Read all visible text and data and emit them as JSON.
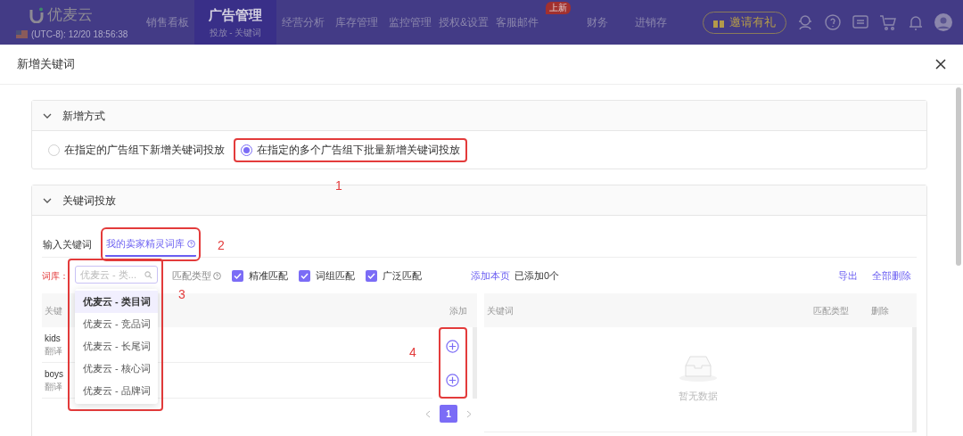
{
  "top_nav": {
    "logo": "优麦云",
    "clock": "(UTC-8): 12/20 18:56:38",
    "items": [
      {
        "label": "销售看板",
        "selected": false
      },
      {
        "label": "广告管理",
        "selected": true,
        "subtitle": "投放 - 关键词"
      },
      {
        "label": "经营分析",
        "selected": false
      },
      {
        "label": "库存管理",
        "selected": false
      },
      {
        "label": "监控管理",
        "selected": false
      },
      {
        "label": "授权&设置",
        "selected": false
      },
      {
        "label": "客服邮件",
        "selected": false,
        "badge": "上新"
      },
      {
        "label": "财务",
        "selected": false
      },
      {
        "label": "进销存",
        "selected": false
      }
    ],
    "invite_button": "邀请有礼"
  },
  "dialog": {
    "title": "新增关键词",
    "method_panel": {
      "title": "新增方式",
      "expanded": true,
      "options": [
        {
          "label": "在指定的广告组下新增关键词投放",
          "selected": false
        },
        {
          "label": "在指定的多个广告组下批量新增关键词投放",
          "selected": true
        }
      ]
    },
    "keyword_panel": {
      "title": "关键词投放",
      "expanded": true,
      "tabs": [
        {
          "label": "输入关键词",
          "selected": false
        },
        {
          "label": "我的卖家精灵词库",
          "selected": true,
          "help": true
        }
      ],
      "library_label": "词库：",
      "library_search": {
        "placeholder": "优麦云 - 类..."
      },
      "match_type_label": "匹配类型",
      "match_types": [
        {
          "label": "精准匹配",
          "checked": true
        },
        {
          "label": "词组匹配",
          "checked": true
        },
        {
          "label": "广泛匹配",
          "checked": true
        }
      ],
      "add_page_link": "添加本页",
      "added_count": "已添加0个",
      "export_link": "导出",
      "delete_all_link": "全部删除",
      "source_table": {
        "columns": [
          "关键",
          "添加"
        ],
        "rows": [
          {
            "keyword": "kids",
            "translate": "翻译"
          },
          {
            "keyword": "boys",
            "translate": "翻译"
          }
        ]
      },
      "target_table": {
        "columns": [
          "关键词",
          "匹配类型",
          "删除"
        ],
        "empty_text": "暂无数据"
      },
      "pagination": [
        {
          "label": "1",
          "selected": true
        }
      ],
      "library_dropdown": [
        {
          "label": "优麦云 - 类目词",
          "selected": true
        },
        {
          "label": "优麦云 - 竞品词",
          "selected": false
        },
        {
          "label": "优麦云 - 长尾词",
          "selected": false
        },
        {
          "label": "优麦云 - 核心词",
          "selected": false
        },
        {
          "label": "优麦云 - 品牌词",
          "selected": false
        }
      ]
    }
  },
  "annotations": [
    "1",
    "2",
    "3",
    "4"
  ]
}
